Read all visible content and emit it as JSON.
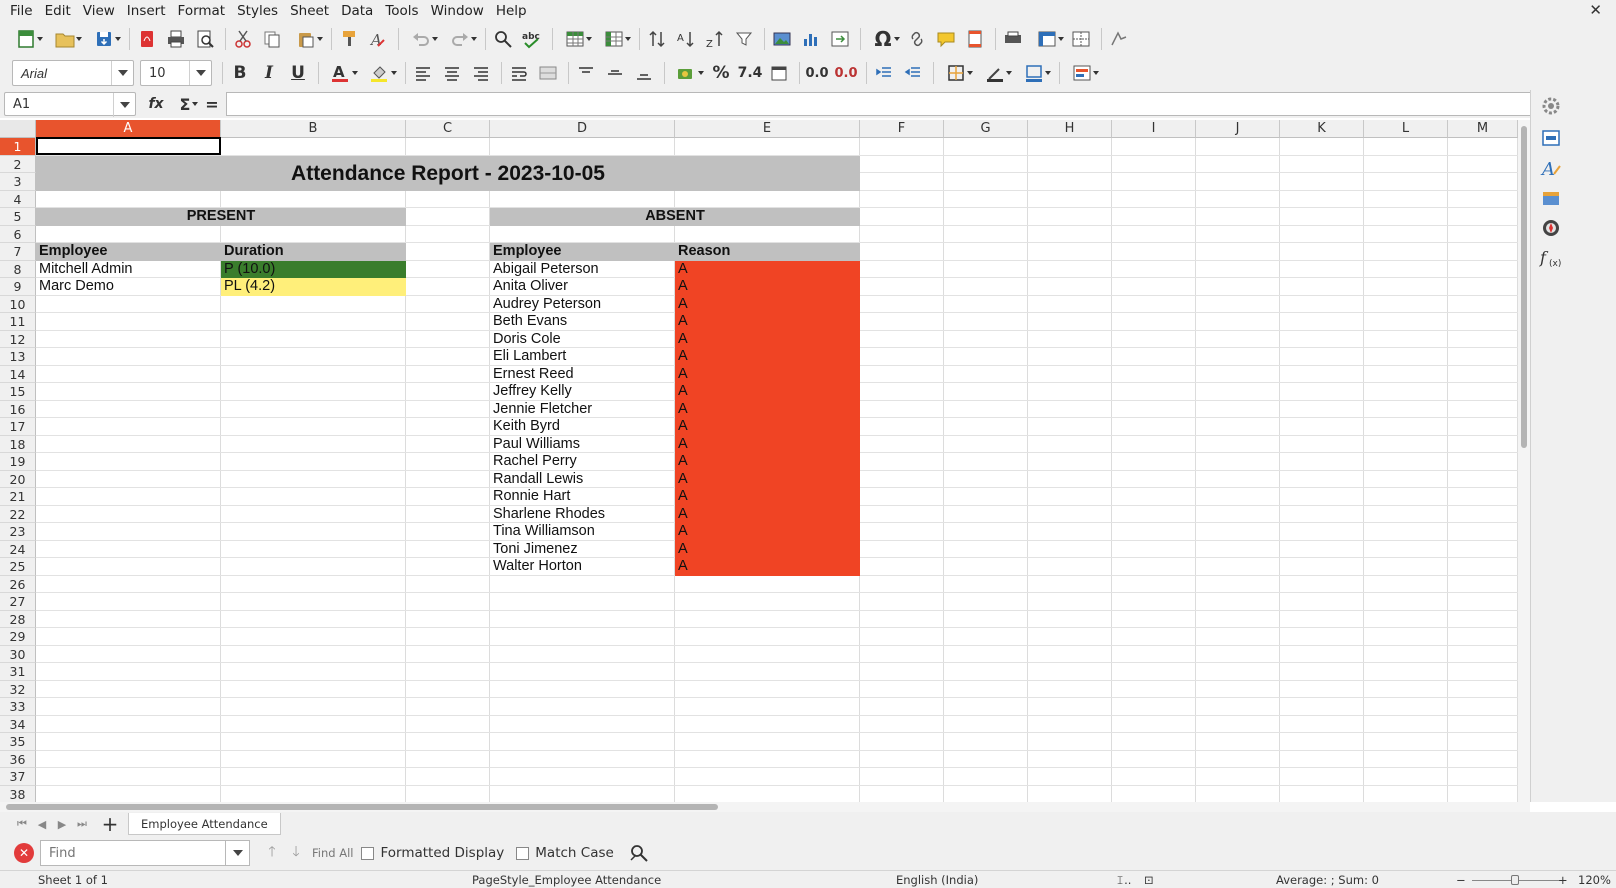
{
  "menubar": {
    "items": [
      "File",
      "Edit",
      "View",
      "Insert",
      "Format",
      "Styles",
      "Sheet",
      "Data",
      "Tools",
      "Window",
      "Help"
    ],
    "close_glyph": "✕"
  },
  "format_toolbar": {
    "font_name": "Arial",
    "font_size": "10",
    "bold_glyph": "B",
    "italic_glyph": "I",
    "underline_glyph": "U",
    "percent_glyph": "%",
    "number_glyph": "7.4",
    "add_decimal_glyph": "0.0",
    "del_decimal_glyph": "0.0"
  },
  "formula_bar": {
    "cell_ref": "A1",
    "fx_glyph": "fx",
    "sum_glyph": "Σ",
    "equals_glyph": "=",
    "content": ""
  },
  "columns": [
    "A",
    "B",
    "C",
    "D",
    "E",
    "F",
    "G",
    "H",
    "I",
    "J",
    "K",
    "L",
    "M"
  ],
  "selected_column": "A",
  "row_numbers": [
    "1",
    "2",
    "3",
    "4",
    "5",
    "6",
    "7",
    "8",
    "9",
    "10",
    "11",
    "12",
    "13",
    "14",
    "15",
    "16",
    "17",
    "18",
    "19",
    "20",
    "21",
    "22",
    "23",
    "24",
    "25",
    "26",
    "27",
    "28",
    "29",
    "30",
    "31",
    "32",
    "33",
    "34",
    "35",
    "36",
    "37",
    "38"
  ],
  "selected_row": "1",
  "sheet": {
    "title": "Attendance Report - 2023-10-05",
    "present_header": "PRESENT",
    "absent_header": "ABSENT",
    "present_columns": [
      "Employee",
      "Duration"
    ],
    "absent_columns": [
      "Employee",
      "Reason"
    ],
    "present_rows": [
      {
        "employee": "Mitchell Admin",
        "duration": "P (10.0)",
        "status": "full"
      },
      {
        "employee": "Marc Demo",
        "duration": "PL (4.2)",
        "status": "partial"
      }
    ],
    "absent_rows": [
      {
        "employee": "Abigail Peterson",
        "reason": "A"
      },
      {
        "employee": "Anita Oliver",
        "reason": "A"
      },
      {
        "employee": "Audrey Peterson",
        "reason": "A"
      },
      {
        "employee": "Beth Evans",
        "reason": "A"
      },
      {
        "employee": "Doris Cole",
        "reason": "A"
      },
      {
        "employee": "Eli Lambert",
        "reason": "A"
      },
      {
        "employee": "Ernest Reed",
        "reason": "A"
      },
      {
        "employee": "Jeffrey Kelly",
        "reason": "A"
      },
      {
        "employee": "Jennie Fletcher",
        "reason": "A"
      },
      {
        "employee": "Keith Byrd",
        "reason": "A"
      },
      {
        "employee": "Paul Williams",
        "reason": "A"
      },
      {
        "employee": "Rachel Perry",
        "reason": "A"
      },
      {
        "employee": "Randall Lewis",
        "reason": "A"
      },
      {
        "employee": "Ronnie Hart",
        "reason": "A"
      },
      {
        "employee": "Sharlene Rhodes",
        "reason": "A"
      },
      {
        "employee": "Tina Williamson",
        "reason": "A"
      },
      {
        "employee": "Toni Jimenez",
        "reason": "A"
      },
      {
        "employee": "Walter Horton",
        "reason": "A"
      }
    ]
  },
  "colors": {
    "header_fill": "#c0c0c0",
    "present_full": "#3a7d2c",
    "present_partial": "#ffef7a",
    "absent_fill": "#f04424",
    "selection_accent": "#e8542d"
  },
  "tabs": {
    "sheet_name": "Employee Attendance",
    "add_glyph": "+"
  },
  "findbar": {
    "placeholder": "Find",
    "find_all": "Find All",
    "formatted_display": "Formatted Display",
    "match_case": "Match Case"
  },
  "statusbar": {
    "sheet_position": "Sheet 1 of 1",
    "page_style": "PageStyle_Employee Attendance",
    "language": "English (India)",
    "aggregate": "Average: ; Sum: 0",
    "zoom_minus": "−",
    "zoom_plus": "+",
    "zoom": "120%"
  }
}
